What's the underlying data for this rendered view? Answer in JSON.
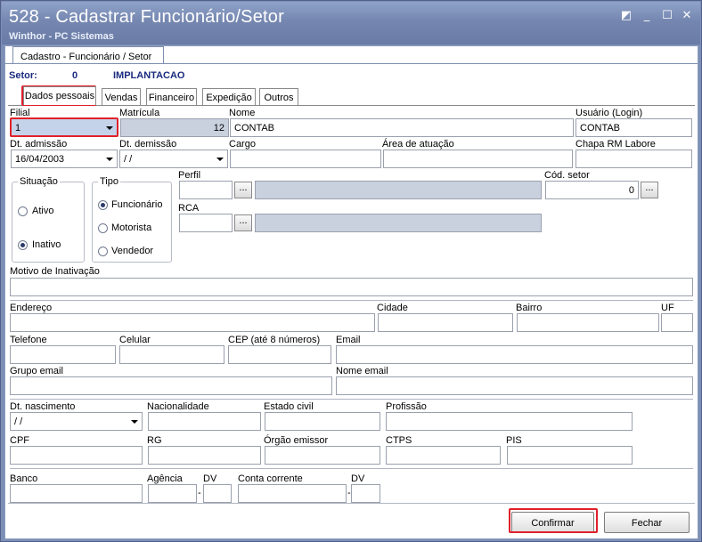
{
  "window": {
    "title": "528 - Cadastrar Funcionário/Setor",
    "subtitle": "Winthor - PC Sistemas",
    "controls": [
      "◩",
      "_",
      "☐",
      "✕"
    ]
  },
  "top_tab": "Cadastro - Funcionário / Setor",
  "setor": {
    "label": "Setor:",
    "code": "0",
    "name": "IMPLANTACAO"
  },
  "tabs": [
    "Dados pessoais",
    "Vendas",
    "Financeiro",
    "Expedição",
    "Outros"
  ],
  "labels": {
    "filial": "Filial",
    "matricula": "Matrícula",
    "nome": "Nome",
    "usuario": "Usuário (Login)",
    "dt_admissao": "Dt. admissão",
    "dt_demissao": "Dt.  demissão",
    "cargo": "Cargo",
    "area": "Área de atuação",
    "chapa": "Chapa RM Labore",
    "situacao": "Situação",
    "ativo": "Ativo",
    "inativo": "Inativo",
    "tipo": "Tipo",
    "funcionario": "Funcionário",
    "motorista": "Motorista",
    "vendedor": "Vendedor",
    "perfil": "Perfil",
    "rca": "RCA",
    "cod_setor": "Cód. setor",
    "motivo": "Motivo de Inativação",
    "endereco": "Endereço",
    "cidade": "Cidade",
    "bairro": "Bairro",
    "uf": "UF",
    "telefone": "Telefone",
    "celular": "Celular",
    "cep": "CEP (até 8 números)",
    "email": "Email",
    "grupo_email": "Grupo email",
    "nome_email": "Nome email",
    "dt_nascimento": "Dt. nascimento",
    "nacionalidade": "Nacionalidade",
    "estado_civil": "Estado civil",
    "profissao": "Profissão",
    "cpf": "CPF",
    "rg": "RG",
    "orgao": "Órgão emissor",
    "ctps": "CTPS",
    "pis": "PIS",
    "banco": "Banco",
    "agencia": "Agência",
    "dv": "DV",
    "conta": "Conta corrente",
    "dv2": "DV"
  },
  "values": {
    "filial": "1",
    "matricula": "12",
    "nome": "CONTAB",
    "usuario": "CONTAB",
    "dt_admissao": "16/04/2003",
    "dt_demissao": " /  /",
    "cod_setor": "0",
    "dt_nascimento": " /  /",
    "dash1": "-",
    "dash2": "-"
  },
  "situacao_selected": "Inativo",
  "tipo_selected": "Funcionário",
  "buttons": {
    "dots": "...",
    "confirmar": "Confirmar",
    "fechar": "Fechar"
  },
  "colors": {
    "highlight": "#e0202a",
    "title_bar": "#7587b0",
    "readonly_field": "#c9d1de"
  }
}
